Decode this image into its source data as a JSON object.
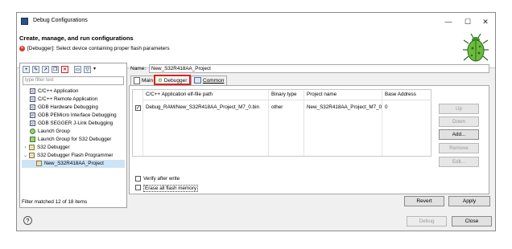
{
  "window": {
    "title": "Debug Configurations",
    "controls": {
      "minimize": "—",
      "maximize": "☐",
      "close": "✕"
    }
  },
  "header": {
    "title": "Create, manage, and run configurations",
    "error": "[Debugger]: Select device containing proper flash parameters",
    "error_icon": "error-icon",
    "logo": "bug-logo"
  },
  "left_panel": {
    "filter_placeholder": "type filter text",
    "tree": [
      {
        "label": "C/C++ Application",
        "icon": "C",
        "indent": 1
      },
      {
        "label": "C/C++ Remote Application",
        "icon": "C",
        "indent": 1
      },
      {
        "label": "GDB Hardware Debugging",
        "icon": "C",
        "indent": 1
      },
      {
        "label": "GDB PEMicro Interface Debugging",
        "icon": "P",
        "indent": 1
      },
      {
        "label": "GDB SEGGER J-Link Debugging",
        "icon": "C",
        "indent": 1
      },
      {
        "label": "Launch Group",
        "icon": "L",
        "indent": 1
      },
      {
        "label": "Launch Group for S32 Debugger",
        "icon": "L",
        "indent": 1
      },
      {
        "label": "S32 Debugger",
        "icon": "S",
        "indent": 0,
        "arrow": "›"
      },
      {
        "label": "S32 Debugger Flash Programmer",
        "icon": "S",
        "indent": 0,
        "arrow": "⌄"
      },
      {
        "label": "New_S32R418AA_Project",
        "icon": "S",
        "indent": 2,
        "selected": true
      }
    ],
    "status": "Filter matched 12 of 18 items"
  },
  "right_panel": {
    "name_label": "Name:",
    "name_value": "New_S32R418AA_Project",
    "tabs": [
      "Main",
      "Debugger",
      "Common"
    ],
    "table": {
      "headers": [
        "C/C++ Application elf-file path",
        "Binary type",
        "Project name",
        "Base Address"
      ],
      "rows": [
        {
          "checked": true,
          "path": "Debug_RAM/New_S32R418AA_Project_M7_0.bin",
          "type": "other",
          "project": "New_S32R418AA_Project_M7_0",
          "address": "0"
        }
      ]
    },
    "side_buttons": [
      "Up",
      "Down",
      "Add...",
      "Remove",
      "Edit..."
    ],
    "verify_label": "Verify after write",
    "erase_label": "Erase all flash memory",
    "revert": "Revert",
    "apply": "Apply"
  },
  "footer": {
    "help": "?",
    "debug": "Debug",
    "close": "Close"
  }
}
